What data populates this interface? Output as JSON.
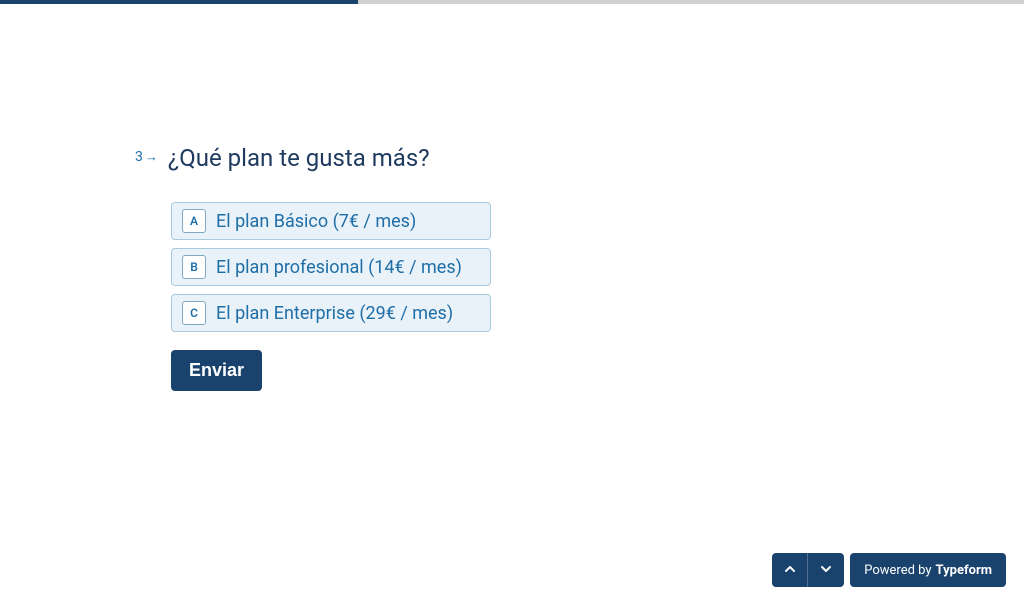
{
  "progress": {
    "percent": 35
  },
  "question": {
    "number": "3",
    "text": "¿Qué plan te gusta más?"
  },
  "options": [
    {
      "key": "A",
      "label": "El plan Básico (7€ / mes)"
    },
    {
      "key": "B",
      "label": "El plan profesional (14€ / mes)"
    },
    {
      "key": "C",
      "label": "El plan Enterprise (29€ / mes)"
    }
  ],
  "submit": {
    "label": "Enviar"
  },
  "footer": {
    "powered_prefix": "Powered by",
    "powered_brand": "Typeform"
  }
}
